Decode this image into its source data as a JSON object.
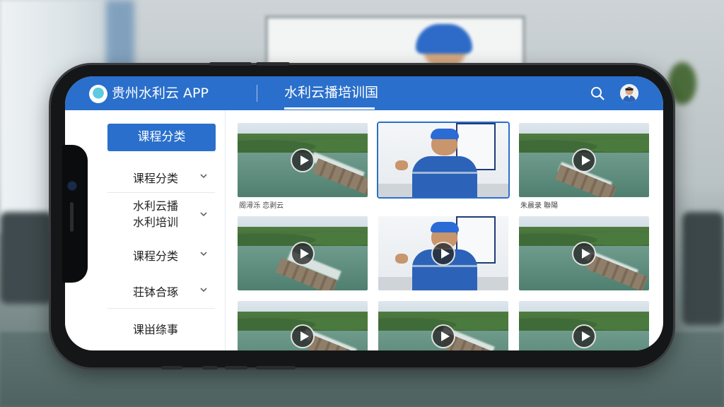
{
  "app": {
    "name": "贵州水利云 APP",
    "page_title": "水利云播培训国"
  },
  "sidebar": {
    "primary_label": "课程分类",
    "items": [
      {
        "label": "课程分类",
        "expandable": true
      },
      {
        "label": "水利云播\n水利培训",
        "expandable": true
      },
      {
        "label": "课程分类",
        "expandable": true
      },
      {
        "label": "荘钵合琢",
        "expandable": true
      },
      {
        "label": "课畄绦事",
        "expandable": false
      }
    ]
  },
  "videos": [
    {
      "scene": "river",
      "caption": "阁潯泺 恋剥云"
    },
    {
      "scene": "instructor",
      "caption": "",
      "selected": true
    },
    {
      "scene": "river",
      "caption": "朱晨录 聯陽"
    },
    {
      "scene": "river",
      "caption": ""
    },
    {
      "scene": "instructor",
      "caption": ""
    },
    {
      "scene": "river",
      "caption": ""
    },
    {
      "scene": "river",
      "caption": ""
    },
    {
      "scene": "river",
      "caption": ""
    },
    {
      "scene": "river",
      "caption": ""
    }
  ],
  "colors": {
    "accent": "#2a6fcb",
    "header_text": "#ffffff"
  },
  "icons": {
    "search": "search-icon",
    "avatar": "user-avatar",
    "chevron": "chevron-down-icon",
    "play": "play-icon"
  }
}
